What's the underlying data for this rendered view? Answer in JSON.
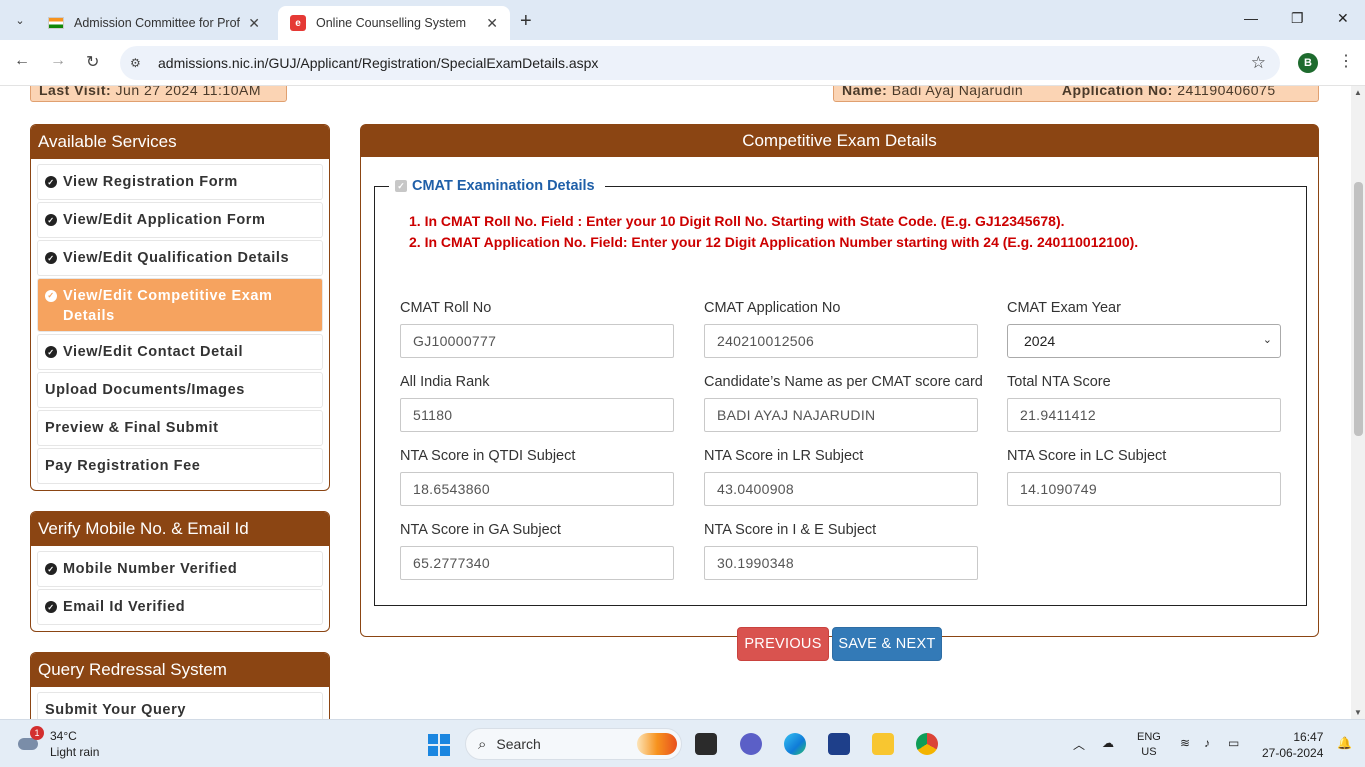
{
  "browser": {
    "tabs": [
      {
        "title": "Admission Committee for Profe",
        "active": false
      },
      {
        "title": "Online Counselling System",
        "active": true
      }
    ],
    "url": "admissions.nic.in/GUJ/Applicant/Registration/SpecialExamDetails.aspx",
    "profile_initial": "B"
  },
  "header": {
    "last_visit_label": "Last Visit:",
    "last_visit_value": "Jun 27 2024 11:10AM",
    "name_label": "Name:",
    "name_value": "Badi Ayaj Najarudin",
    "app_no_label": "Application No:",
    "app_no_value": "241190406075"
  },
  "services": {
    "title": "Available Services",
    "items": [
      {
        "label": "View Registration Form",
        "icon": "check-circle-icon"
      },
      {
        "label": "View/Edit Application Form",
        "icon": "check-circle-icon"
      },
      {
        "label": "View/Edit Qualification Details",
        "icon": "check-circle-icon"
      },
      {
        "label": "View/Edit Competitive Exam Details",
        "icon": "check-circle-icon",
        "active": true
      },
      {
        "label": "View/Edit Contact Detail",
        "icon": "check-circle-icon"
      },
      {
        "label": "Upload Documents/Images",
        "icon": "clock-icon"
      },
      {
        "label": "Preview & Final Submit",
        "icon": "clock-icon"
      },
      {
        "label": "Pay Registration Fee",
        "icon": "clock-icon"
      }
    ]
  },
  "verify": {
    "title": "Verify Mobile No. & Email Id",
    "items": [
      {
        "label": "Mobile Number Verified"
      },
      {
        "label": "Email Id Verified"
      }
    ]
  },
  "query": {
    "title": "Query Redressal System",
    "items": [
      {
        "label": "Submit Your Query"
      }
    ]
  },
  "main": {
    "title": "Competitive Exam Details",
    "legend": "CMAT Examination Details",
    "notes": [
      "1. In CMAT Roll No. Field : Enter your 10 Digit Roll No. Starting with State Code. (E.g. GJ12345678).",
      "2. In CMAT Application No. Field: Enter your 12 Digit Application Number starting with 24 (E.g. 240110012100)."
    ],
    "fields": {
      "roll_no": {
        "label": "CMAT Roll No",
        "value": "GJ10000777"
      },
      "app_no": {
        "label": "CMAT Application No",
        "value": "240210012506"
      },
      "exam_year": {
        "label": "CMAT Exam Year",
        "value": "2024"
      },
      "rank": {
        "label": "All India Rank",
        "value": "51180"
      },
      "cand_name": {
        "label": "Candidate’s Name as per CMAT score card",
        "value": "BADI AYAJ NAJARUDIN"
      },
      "total_score": {
        "label": "Total NTA Score",
        "value": "21.9411412"
      },
      "qtdi": {
        "label": "NTA Score in QTDI Subject",
        "value": "18.6543860"
      },
      "lr": {
        "label": "NTA Score in LR Subject",
        "value": "43.0400908"
      },
      "lc": {
        "label": "NTA Score in LC Subject",
        "value": "14.1090749"
      },
      "ga": {
        "label": "NTA Score in GA Subject",
        "value": "65.2777340"
      },
      "ie": {
        "label": "NTA Score in I & E Subject",
        "value": "30.1990348"
      }
    },
    "prev_label": "PREVIOUS",
    "next_label": "SAVE & NEXT"
  },
  "taskbar": {
    "temp": "34°C",
    "weather": "Light rain",
    "weather_badge": "1",
    "search_placeholder": "Search",
    "lang_top": "ENG",
    "lang_bottom": "US",
    "time": "16:47",
    "date": "27-06-2024"
  },
  "colors": {
    "brand_brown": "#8b4513",
    "active_orange": "#f6a35f",
    "note_red": "#cc0000",
    "prev_red": "#d9534f",
    "next_blue": "#337ab7"
  }
}
